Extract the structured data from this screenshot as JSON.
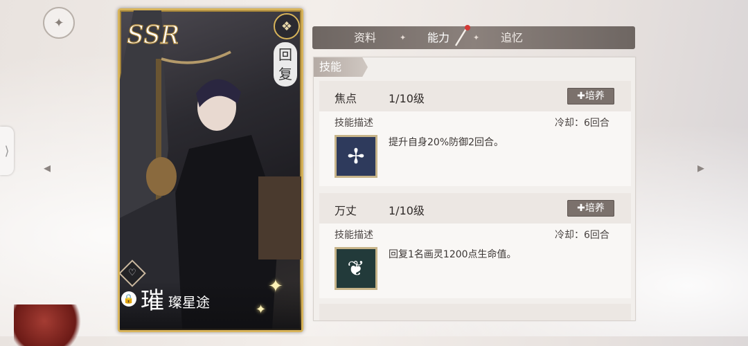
{
  "nav": {
    "side_tab_glyph": "⟩",
    "arrow_left_glyph": "◂",
    "arrow_right_glyph": "▸",
    "home_icon": "compass-icon"
  },
  "card": {
    "rarity": "SSR",
    "type_label": "回复",
    "name_main": "璀",
    "name_title": "璨星途",
    "emblem_icon": "knot-emblem-icon",
    "heart_glyph": "♡",
    "lock_glyph": "🔒",
    "colors": {
      "frame": "#d8b45a"
    }
  },
  "tabs": [
    {
      "label": "资料",
      "active": false
    },
    {
      "label": "能力",
      "active": true
    },
    {
      "label": "追忆",
      "active": false
    }
  ],
  "tab_separator": "✦",
  "section": {
    "label": "技能"
  },
  "skills": [
    {
      "name": "焦点",
      "level": "1/10级",
      "train_label": "✚培养",
      "desc_label": "技能描述",
      "cooldown": "冷却：6回合",
      "icon": "winged-cross-icon",
      "icon_glyph": "✢",
      "description": "提升自身20%防御2回合。"
    },
    {
      "name": "万丈",
      "level": "1/10级",
      "train_label": "✚培养",
      "desc_label": "技能描述",
      "cooldown": "冷却：6回合",
      "icon": "leaf-sparkle-icon",
      "icon_glyph": "❦",
      "description": "回复1名画灵1200点生命值。"
    }
  ]
}
